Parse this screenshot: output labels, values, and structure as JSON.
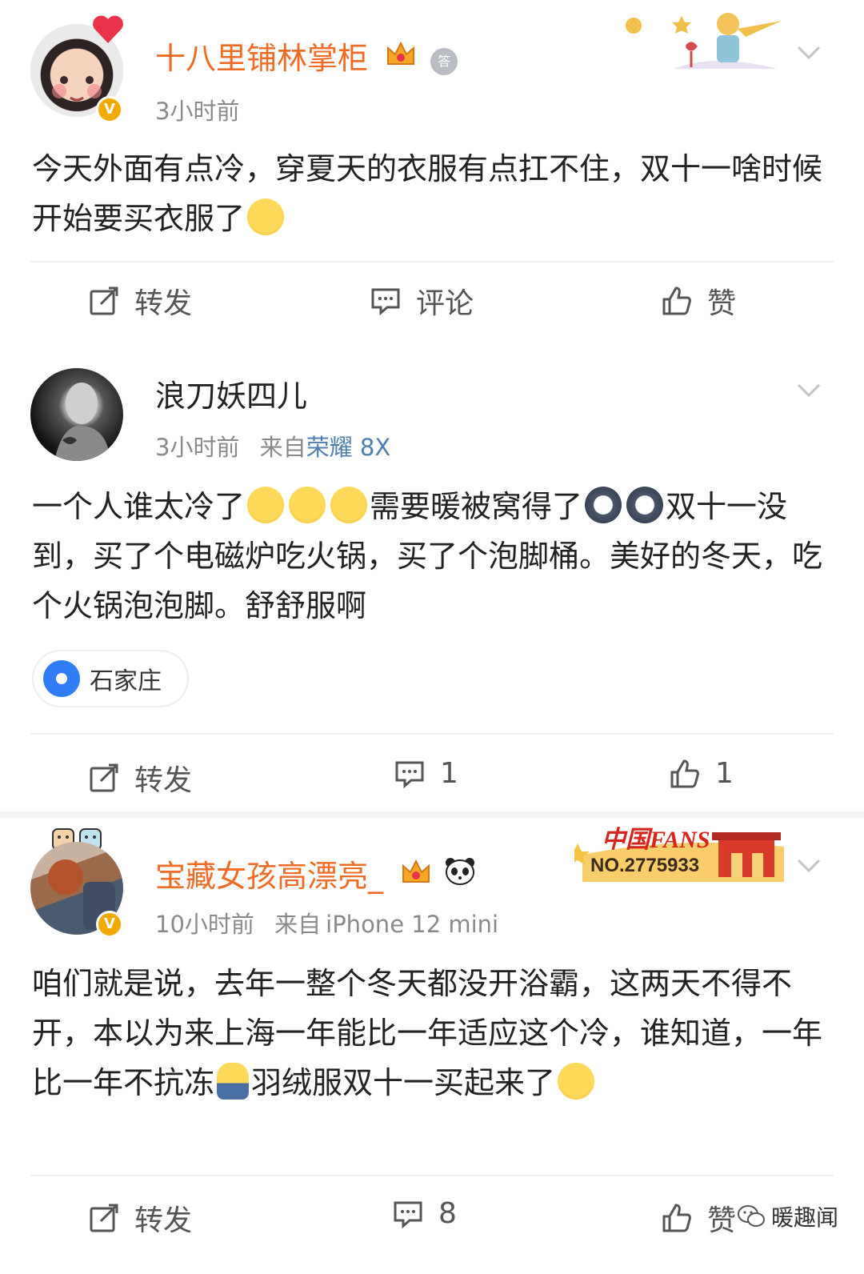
{
  "posts": [
    {
      "name": "十八里铺林掌柜",
      "medal": "答",
      "time": "3小时前",
      "content_1": "今天外面有点冷，穿夏天的衣服有点扛不住，双十一啥时候开始要买衣服了",
      "actions": {
        "repost": "转发",
        "comment": "评论",
        "like": "赞"
      }
    },
    {
      "name": "浪刀妖四儿",
      "time": "3小时前",
      "from_label": "来自",
      "source": "荣耀 8X",
      "content_1": "一个人谁太冷了",
      "content_2": "需要暖被窝得了",
      "content_3": "双十一没到，买了个电磁炉吃火锅，买了个泡脚桶。美好的冬天，吃个火锅泡泡脚。舒舒服啊",
      "location": "石家庄",
      "actions": {
        "repost": "转发",
        "comment": "1",
        "like": "1"
      }
    },
    {
      "name": "宝藏女孩高漂亮_",
      "fans_title": "中国FANS",
      "fans_no": "NO.2775933",
      "time": "10小时前",
      "from_label": "来自",
      "source": "iPhone 12 mini",
      "content_1": "咱们就是说，去年一整个冬天都没开浴霸，这两天不得不开，本以为来上海一年能比一年适应这个冷，谁知道，一年比一年不抗冻",
      "content_2": "羽绒服双十一买起来了",
      "actions": {
        "repost": "转发",
        "comment": "8",
        "like": "赞"
      }
    }
  ],
  "watermark": "暖趣闻",
  "icons": [
    "repost-icon",
    "comment-icon",
    "like-icon",
    "chevron-down-icon",
    "location-pin-icon",
    "verified-icon",
    "crown-icon",
    "panda-icon",
    "medal-icon"
  ],
  "colors": {
    "vip_name": "#f06b24",
    "source_link": "#4d7eb0",
    "verified": "#f2a900",
    "location_pin": "#2f7cf6"
  }
}
